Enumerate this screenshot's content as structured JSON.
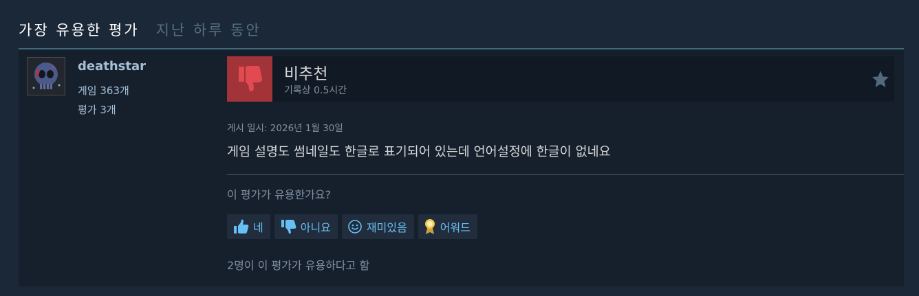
{
  "header": {
    "title": "가장 유용한 평가",
    "subtitle": "지난 하루 동안"
  },
  "author": {
    "name": "deathstar",
    "games": "게임 363개",
    "reviews": "평가 3개"
  },
  "review": {
    "verdict": "비추천",
    "hours": "기록상 0.5시간",
    "posted": "게시 일시: 2026년 1월 30일",
    "content": "게임 설명도 썸네일도 한글로 표기되어 있는데 언어설정에 한글이 없네요",
    "question": "이 평가가 유용한가요?",
    "helpful_count": "2명이 이 평가가 유용하다고 함"
  },
  "votes": {
    "yes": "네",
    "no": "아니요",
    "funny": "재미있음",
    "award": "어워드"
  },
  "colors": {
    "background": "#1b2838",
    "panel": "#16202d",
    "thumb_down": "#a23439",
    "link_blue": "#66c0f4"
  },
  "icons": {
    "verdict": "thumbs-down-icon",
    "favorite": "star-icon",
    "yes": "thumbs-up-icon",
    "no": "thumbs-down-icon",
    "funny": "smiley-icon",
    "award": "award-medal-icon"
  }
}
